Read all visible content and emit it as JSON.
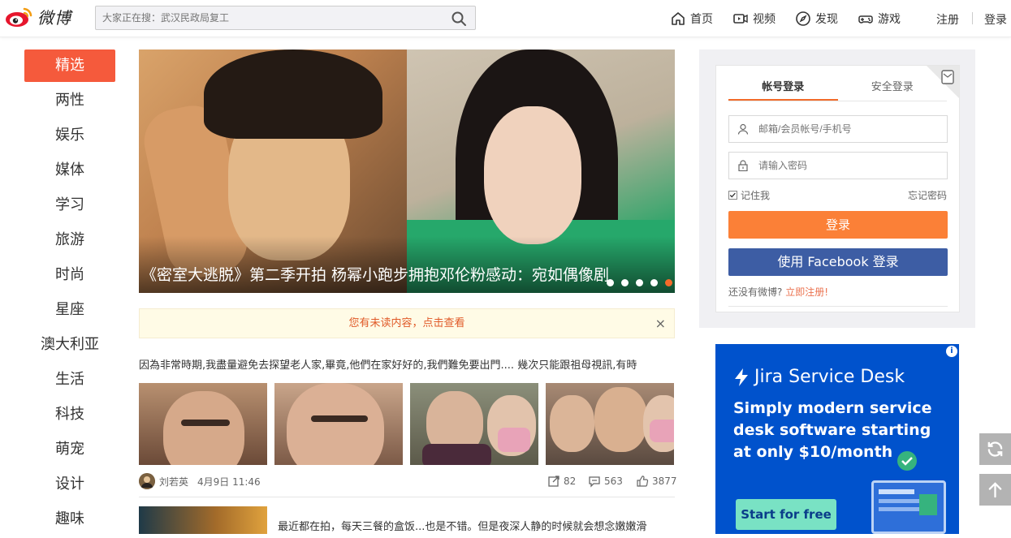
{
  "header": {
    "logo_text": "微博",
    "search_placeholder": "大家正在搜：武汉民政局复工",
    "nav": [
      {
        "label": "首页",
        "icon": "home-icon"
      },
      {
        "label": "视频",
        "icon": "video-icon"
      },
      {
        "label": "发现",
        "icon": "compass-icon"
      },
      {
        "label": "游戏",
        "icon": "gamepad-icon"
      }
    ],
    "register": "注册",
    "login": "登录"
  },
  "sidebar": {
    "items": [
      "精选",
      "两性",
      "娱乐",
      "媒体",
      "学习",
      "旅游",
      "时尚",
      "星座",
      "澳大利亚",
      "生活",
      "科技",
      "萌宠",
      "设计",
      "趣味"
    ],
    "active_index": 0
  },
  "banner": {
    "caption": "《密室大逃脱》第二季开拍   杨幂小跑步拥抱邓伦粉感动：宛如偶像剧",
    "dots": 5,
    "active_dot": 4
  },
  "notice": {
    "text": "您有未读内容，点击查看",
    "close": "×"
  },
  "feed": [
    {
      "text": "因為非常時期,我盡量避免去探望老人家,畢竟,他們在家好好的,我們難免要出門.... 幾次只能跟祖母視訊,有時",
      "author": "刘若英",
      "date": "4月9日 11:46",
      "shares": "82",
      "comments": "563",
      "likes": "3877"
    },
    {
      "text": "最近都在拍，每天三餐的盒饭...也是不错。但是夜深人静的时候就会想念嫩嫩滑"
    }
  ],
  "login": {
    "tab_account": "帐号登录",
    "tab_secure": "安全登录",
    "username_placeholder": "邮箱/会员帐号/手机号",
    "password_placeholder": "请输入密码",
    "remember": "记住我",
    "forgot": "忘记密码",
    "login_button": "登录",
    "facebook_button": "使用 Facebook 登录",
    "signup_prompt": "还没有微博?",
    "signup_link": "立即注册!"
  },
  "ad": {
    "brand": "Jira Service Desk",
    "copy": "Simply modern service desk software starting at only $10/month",
    "cta": "Start for free",
    "info": "i"
  },
  "colors": {
    "accent": "#f55a3c",
    "login_button": "#fb8037",
    "facebook": "#3d5da4",
    "ad_bg": "#0052cc"
  }
}
